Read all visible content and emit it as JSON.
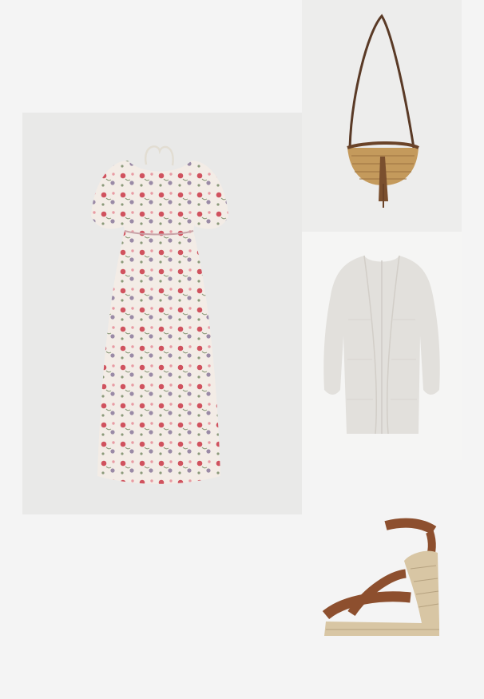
{
  "board": {
    "items": [
      {
        "name": "floral-puff-sleeve-maxi-dress",
        "icon": "dress-image"
      },
      {
        "name": "woven-straw-crossbody-bag",
        "icon": "bag-image"
      },
      {
        "name": "open-knit-long-cardigan",
        "icon": "cardigan-image"
      },
      {
        "name": "ankle-tie-espadrille-wedge",
        "icon": "wedge-sandal-image"
      }
    ],
    "colors": {
      "background": "#f4f4f4",
      "dress_base": "#f3ece6",
      "dress_print_red": "#d0525e",
      "dress_print_mauve": "#9a8aa6",
      "bag_straw": "#c49a5c",
      "bag_strap": "#5a3a26",
      "cardigan": "#e2e0dc",
      "sandal_strap": "#8d4f2e",
      "sandal_jute": "#d8c6a4"
    }
  }
}
